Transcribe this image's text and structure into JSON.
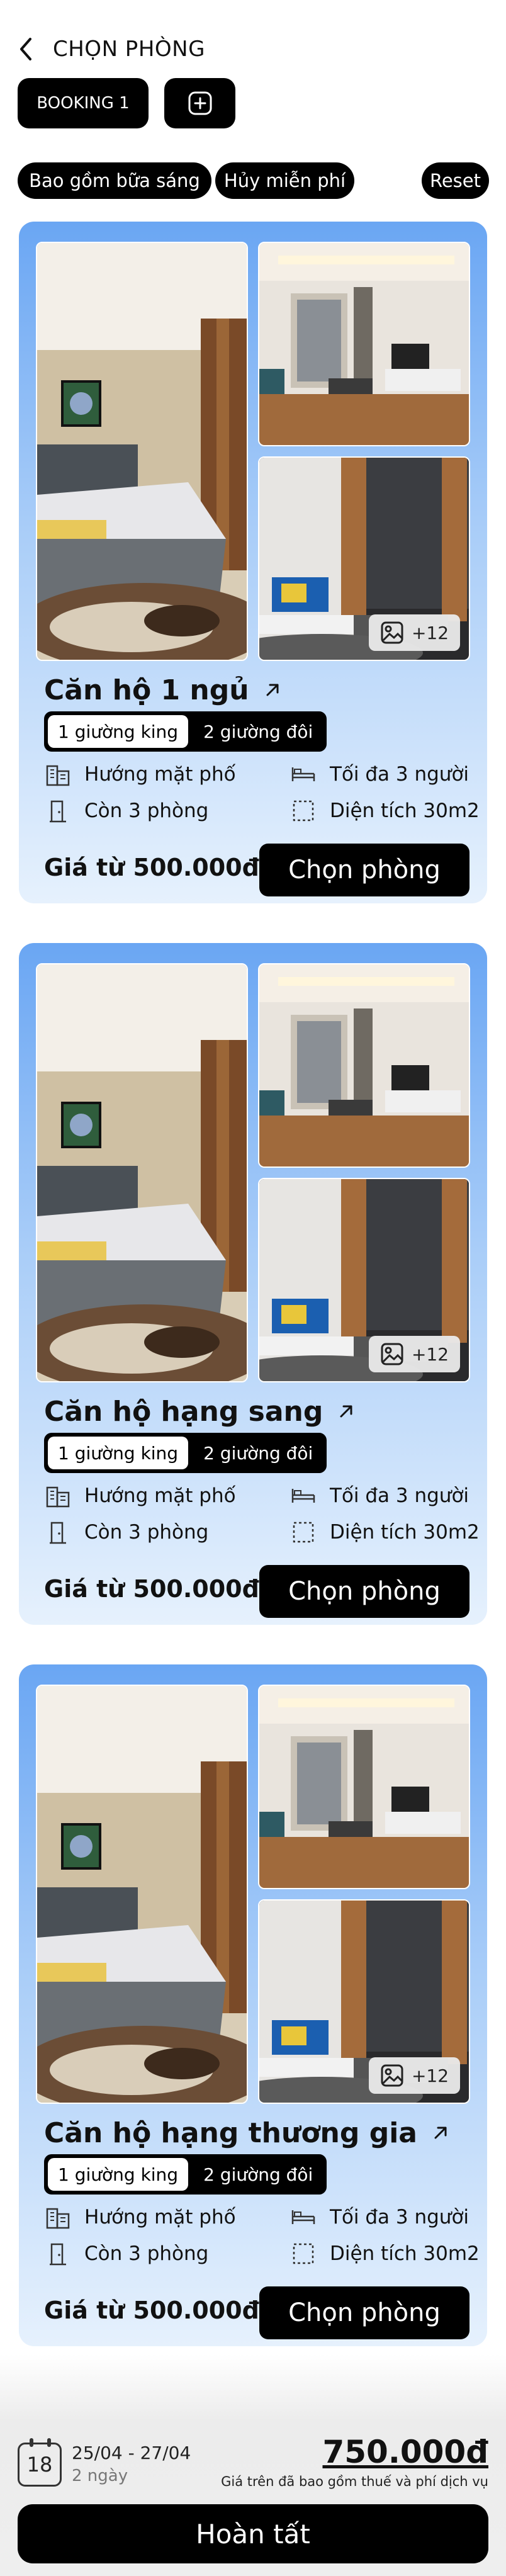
{
  "header": {
    "title": "CHỌN PHÒNG"
  },
  "booking": {
    "tab_label": "BOOKING 1"
  },
  "filters": [
    {
      "label": "Bao gồm bữa sáng"
    },
    {
      "label": "Hủy miễn phí"
    },
    {
      "label": "Reset"
    }
  ],
  "rooms": [
    {
      "name": "Căn hộ 1 ngủ",
      "more_photos": "+12",
      "bed_options": [
        "1 giường king",
        "2 giường đôi"
      ],
      "selected_bed": "1 giường king",
      "features": {
        "view": "Hướng mặt phố",
        "availability": "Còn 3 phòng",
        "capacity": "Tối đa 3 người",
        "area": "Diện tích 30m2"
      },
      "price_label": "Giá từ 500.000đ",
      "select_label": "Chọn phòng"
    },
    {
      "name": "Căn hộ hạng sang",
      "more_photos": "+12",
      "bed_options": [
        "1 giường king",
        "2 giường đôi"
      ],
      "selected_bed": "1 giường king",
      "features": {
        "view": "Hướng mặt phố",
        "availability": "Còn 3 phòng",
        "capacity": "Tối đa 3 người",
        "area": "Diện tích 30m2"
      },
      "price_label": "Giá từ 500.000đ",
      "select_label": "Chọn phòng"
    },
    {
      "name": "Căn hộ hạng thương gia",
      "more_photos": "+12",
      "bed_options": [
        "1 giường king",
        "2 giường đôi"
      ],
      "selected_bed": "1 giường king",
      "features": {
        "view": "Hướng mặt phố",
        "availability": "Còn 3 phòng",
        "capacity": "Tối đa 3 người",
        "area": "Diện tích 30m2"
      },
      "price_label": "Giá từ 500.000đ",
      "select_label": "Chọn phòng"
    }
  ],
  "footer": {
    "calendar_day": "18",
    "date_range": "25/04 - 27/04",
    "nights": "2 ngày",
    "total": "750.000đ",
    "total_note": "Giá trên đã bao gồm thuế và phí dịch vụ",
    "done_label": "Hoàn tất"
  },
  "colors": {
    "card_gradient_top": "#6aa6f3",
    "card_gradient_bottom": "#e6f1fd",
    "primary": "#000000"
  }
}
